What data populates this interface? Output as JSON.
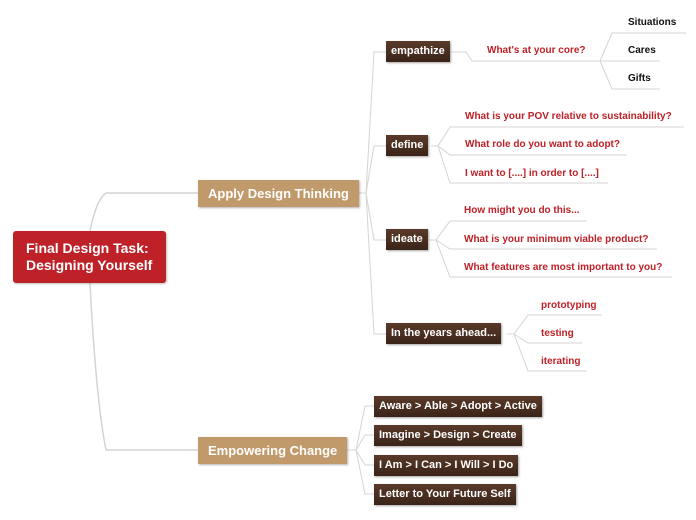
{
  "root": {
    "line1": "Final Design Task:",
    "line2": "Designing Yourself",
    "color": "#be2128"
  },
  "branches": [
    {
      "label": "Apply Design Thinking",
      "color": "#c09a6b",
      "children": [
        {
          "label": "empathize",
          "children": [
            {
              "label": "What's at your core?",
              "children": [
                "Situations",
                "Cares",
                "Gifts"
              ]
            }
          ]
        },
        {
          "label": "define",
          "children": [
            "What is your POV relative to sustainability?",
            "What role do you want to adopt?",
            "I want to [....] in order to [....]"
          ]
        },
        {
          "label": "ideate",
          "children": [
            "How might you do this...",
            "What is your minimum viable product?",
            "What features are most important to you?"
          ]
        },
        {
          "label": "In the years ahead...",
          "children": [
            "prototyping",
            "testing",
            "iterating"
          ]
        }
      ]
    },
    {
      "label": "Empowering Change",
      "color": "#c09a6b",
      "children": [
        "Aware > Able > Adopt > Active",
        "Imagine > Design > Create",
        "I Am > I Can > I Will > I Do",
        "Letter to Your Future Self"
      ]
    }
  ],
  "colors": {
    "leaf_text": "#be2128",
    "dark_node": "#3a2418",
    "connector": "#d0d0d0"
  }
}
